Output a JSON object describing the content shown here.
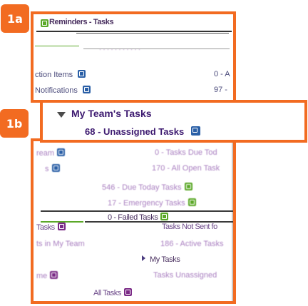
{
  "callouts": {
    "a": "1a",
    "b": "1b"
  },
  "reminders_header": {
    "title": "Reminders - Tasks"
  },
  "panel_a_rows": [
    {
      "label": "ction Items",
      "value": "0 - A"
    },
    {
      "label": "Notifications",
      "value": "97 -"
    }
  ],
  "my_team": {
    "title": "My Team's Tasks",
    "link": "68 - Unassigned Tasks"
  },
  "lower_rows": [
    {
      "left": "ream",
      "right": "0 - Tasks Due Tod"
    },
    {
      "left": "s",
      "right": "170 - All Open Task"
    },
    {
      "center": "546 - Due Today Tasks"
    },
    {
      "center": "17 - Emergency Tasks"
    },
    {
      "center": "0 - Failed Tasks"
    },
    {
      "left": "Tasks",
      "right": "Tasks Not Sent fo"
    },
    {
      "left": "ts in My Team",
      "right": "186 - Active Tasks"
    },
    {
      "center": "My Tasks"
    },
    {
      "left": "me",
      "right": "Tasks Unassigned"
    },
    {
      "center": "All Tasks"
    }
  ],
  "colors": {
    "accent": "#f26b21",
    "link": "#3d1a70",
    "icon_blue": "#2a5fa6",
    "icon_green": "#5ba828"
  }
}
